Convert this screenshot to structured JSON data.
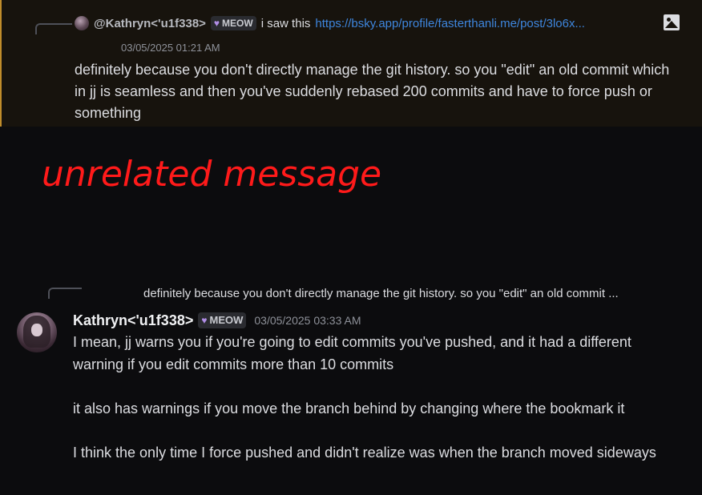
{
  "message1": {
    "reply": {
      "author": "@Kathryn<'u1f338>",
      "badge": "MEOW",
      "text": "i saw this",
      "link": "https://bsky.app/profile/fasterthanli.me/post/3lo6x..."
    },
    "timestamp": "03/05/2025 01:21 AM",
    "body": "definitely because you don't directly manage the git history. so you \"edit\" an old commit which in jj is seamless and then you've suddenly rebased 200 commits and have to force push or something"
  },
  "annotation": {
    "text": "unrelated message",
    "color": "#ff1a1a"
  },
  "message2": {
    "reply_text": "definitely because you don't directly manage the git history. so you \"edit\" an old commit ...",
    "author": "Kathryn<'u1f338>",
    "badge": "MEOW",
    "timestamp": "03/05/2025 03:33 AM",
    "paragraphs": [
      "I mean, jj warns you if you're going to edit commits you've pushed, and it had a different warning if you edit commits more than 10 commits",
      "it also has warnings if you move the branch behind by changing where the bookmark it",
      "I think the only time I force pushed and didn't realize was when the branch moved sideways"
    ]
  },
  "colors": {
    "highlight_bg": "#17130d",
    "highlight_border": "#c08d2b",
    "link": "#3e86de",
    "badge_heart": "#b28ee8"
  },
  "icons": [
    "image-icon",
    "heart-icon"
  ]
}
